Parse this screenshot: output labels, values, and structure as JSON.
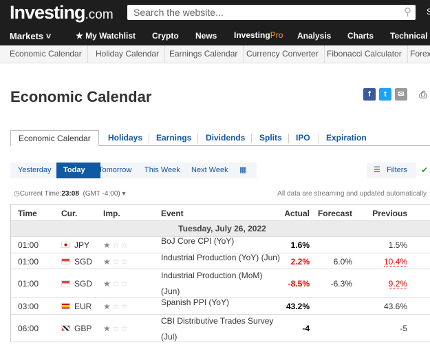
{
  "header": {
    "logo": "Investing",
    "logo_suffix": ".com",
    "search_placeholder": "Search the website...",
    "right_cut": "S"
  },
  "nav": {
    "items": [
      "Markets",
      "My Watchlist",
      "Crypto",
      "News",
      "Investing",
      "Pro",
      "Analysis",
      "Charts",
      "Technical"
    ]
  },
  "subnav": [
    "Economic Calendar",
    "Holiday Calendar",
    "Earnings Calendar",
    "Currency Converter",
    "Fibonacci Calculator",
    "Forex"
  ],
  "page_title": "Economic Calendar",
  "tabs": [
    "Economic Calendar",
    "Holidays",
    "Earnings",
    "Dividends",
    "Splits",
    "IPO",
    "Expiration"
  ],
  "date_buttons": [
    "Yesterday",
    "Today",
    "Tomorrow",
    "This Week",
    "Next Week"
  ],
  "filters_label": "Filters",
  "current_time": {
    "label": "Current Time:",
    "value": "23:08",
    "tz": "(GMT -4:00)"
  },
  "streaming_note": "All data are streaming and updated automatically.",
  "table": {
    "headers": [
      "Time",
      "Cur.",
      "Imp.",
      "Event",
      "Actual",
      "Forecast",
      "Previous"
    ],
    "date": "Tuesday, July 26, 2022",
    "rows": [
      {
        "time": "01:00",
        "cur": "JPY",
        "flag": "japan",
        "imp": 1,
        "event": "BoJ Core CPI (YoY)",
        "actual": "1.6%",
        "forecast": "",
        "previous": "1.5%",
        "actual_color": "#000",
        "prev_red": false
      },
      {
        "time": "01:00",
        "cur": "SGD",
        "flag": "singapore",
        "imp": 1,
        "event": "Industrial Production (YoY) (Jun)",
        "actual": "2.2%",
        "forecast": "6.0%",
        "previous": "10.4%",
        "actual_color": "#e00",
        "prev_red": true
      },
      {
        "time": "01:00",
        "cur": "SGD",
        "flag": "singapore",
        "imp": 1,
        "event": "Industrial Production (MoM) (Jun)",
        "actual": "-8.5%",
        "forecast": "-6.3%",
        "previous": "9.2%",
        "actual_color": "#e00",
        "prev_red": true
      },
      {
        "time": "03:00",
        "cur": "EUR",
        "flag": "spain",
        "imp": 1,
        "event": "Spanish PPI (YoY)",
        "actual": "43.2%",
        "forecast": "",
        "previous": "43.6%",
        "actual_color": "#000",
        "prev_red": false
      },
      {
        "time": "06:00",
        "cur": "GBP",
        "flag": "uk",
        "imp": 1,
        "event": "CBI Distributive Trades Survey (Jul)",
        "actual": "-4",
        "forecast": "",
        "previous": "-5",
        "actual_color": "#000",
        "prev_red": false
      }
    ]
  },
  "colors": {
    "accent": "#0f5aa3",
    "link": "#1256a0",
    "negative": "#e00",
    "pro": "#f7a21b"
  }
}
